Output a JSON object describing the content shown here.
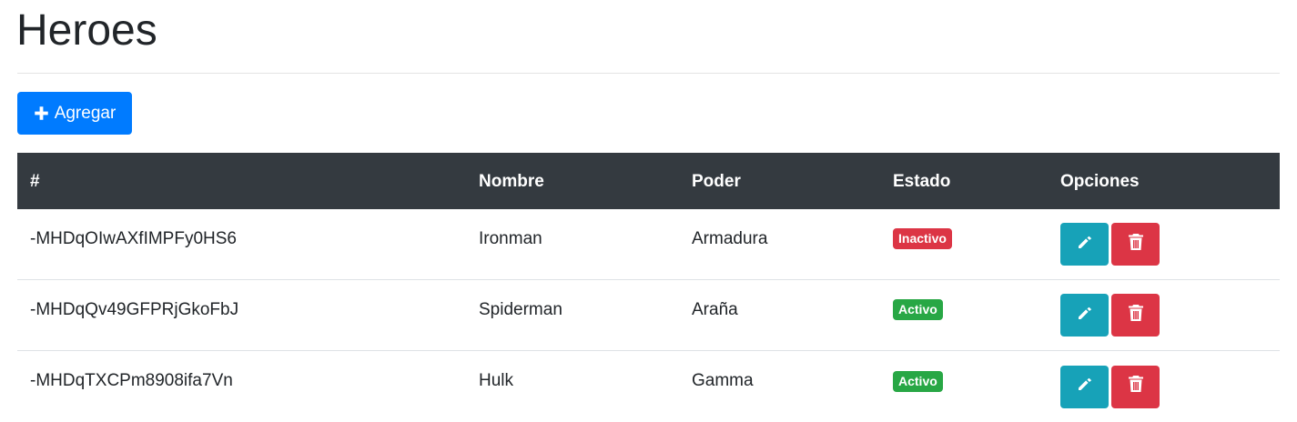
{
  "page": {
    "title": "Heroes"
  },
  "toolbar": {
    "add_label": "Agregar",
    "add_icon": "plus-icon"
  },
  "table": {
    "headers": {
      "id": "#",
      "nombre": "Nombre",
      "poder": "Poder",
      "estado": "Estado",
      "opciones": "Opciones"
    },
    "rows": [
      {
        "id": "-MHDqOIwAXfIMPFy0HS6",
        "nombre": "Ironman",
        "poder": "Armadura",
        "estado": "Inactivo",
        "estado_type": "inactive"
      },
      {
        "id": "-MHDqQv49GFPRjGkoFbJ",
        "nombre": "Spiderman",
        "poder": "Araña",
        "estado": "Activo",
        "estado_type": "active"
      },
      {
        "id": "-MHDqTXCPm8908ifa7Vn",
        "nombre": "Hulk",
        "poder": "Gamma",
        "estado": "Activo",
        "estado_type": "active"
      }
    ],
    "row_actions": {
      "edit_icon": "pencil-icon",
      "delete_icon": "trash-icon"
    }
  },
  "colors": {
    "primary": "#007bff",
    "header_bg": "#343a40",
    "info": "#17a2b8",
    "danger": "#dc3545",
    "success": "#28a745"
  }
}
